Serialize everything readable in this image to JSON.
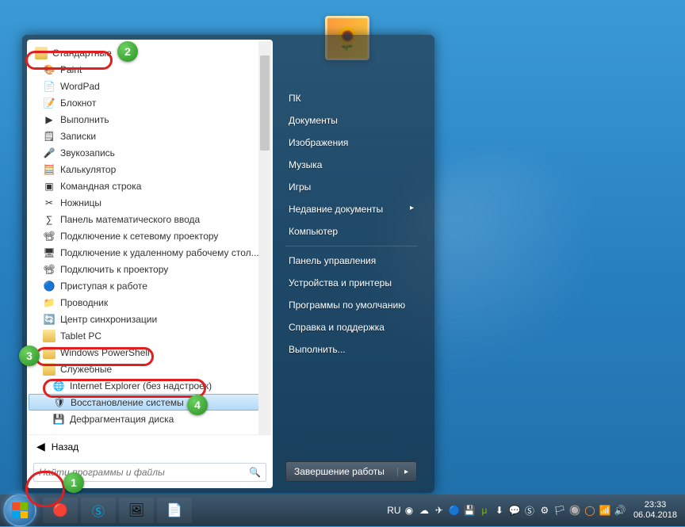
{
  "folder_label": "Стандартные",
  "programs": [
    {
      "name": "Paint",
      "icon": "🎨"
    },
    {
      "name": "WordPad",
      "icon": "📄"
    },
    {
      "name": "Блокнот",
      "icon": "📝"
    },
    {
      "name": "Выполнить",
      "icon": "▶"
    },
    {
      "name": "Записки",
      "icon": "🗒"
    },
    {
      "name": "Звукозапись",
      "icon": "🎤"
    },
    {
      "name": "Калькулятор",
      "icon": "🧮"
    },
    {
      "name": "Командная строка",
      "icon": "▣"
    },
    {
      "name": "Ножницы",
      "icon": "✂"
    },
    {
      "name": "Панель математического ввода",
      "icon": "∑"
    },
    {
      "name": "Подключение к сетевому проектору",
      "icon": "📽"
    },
    {
      "name": "Подключение к удаленному рабочему стол...",
      "icon": "🖥"
    },
    {
      "name": "Подключить к проектору",
      "icon": "📽"
    },
    {
      "name": "Приступая к работе",
      "icon": "🔵"
    },
    {
      "name": "Проводник",
      "icon": "📁"
    },
    {
      "name": "Центр синхронизации",
      "icon": "🔄"
    }
  ],
  "subfolders": [
    {
      "name": "Tablet PC"
    },
    {
      "name": "Windows PowerShell"
    },
    {
      "name": "Служебные"
    }
  ],
  "sub_items": [
    {
      "name": "Internet Explorer (без надстроек)",
      "icon": "🌐"
    },
    {
      "name": "Восстановление системы",
      "icon": "🛡",
      "selected": true
    },
    {
      "name": "Дефрагментация диска",
      "icon": "💾"
    }
  ],
  "back_label": "Назад",
  "search_placeholder": "Найти программы и файлы",
  "right_items": {
    "r0": "ПК",
    "r1": "Документы",
    "r2": "Изображения",
    "r3": "Музыка",
    "r4": "Игры",
    "r5": "Недавние документы",
    "r6": "Компьютер",
    "r7": "Панель управления",
    "r8": "Устройства и принтеры",
    "r9": "Программы по умолчанию",
    "r10": "Справка и поддержка",
    "r11": "Выполнить..."
  },
  "shutdown_label": "Завершение работы",
  "lang_indicator": "RU",
  "clock": {
    "time": "23:33",
    "date": "06.04.2018"
  },
  "annotations": {
    "a1": "1",
    "a2": "2",
    "a3": "3",
    "a4": "4"
  }
}
